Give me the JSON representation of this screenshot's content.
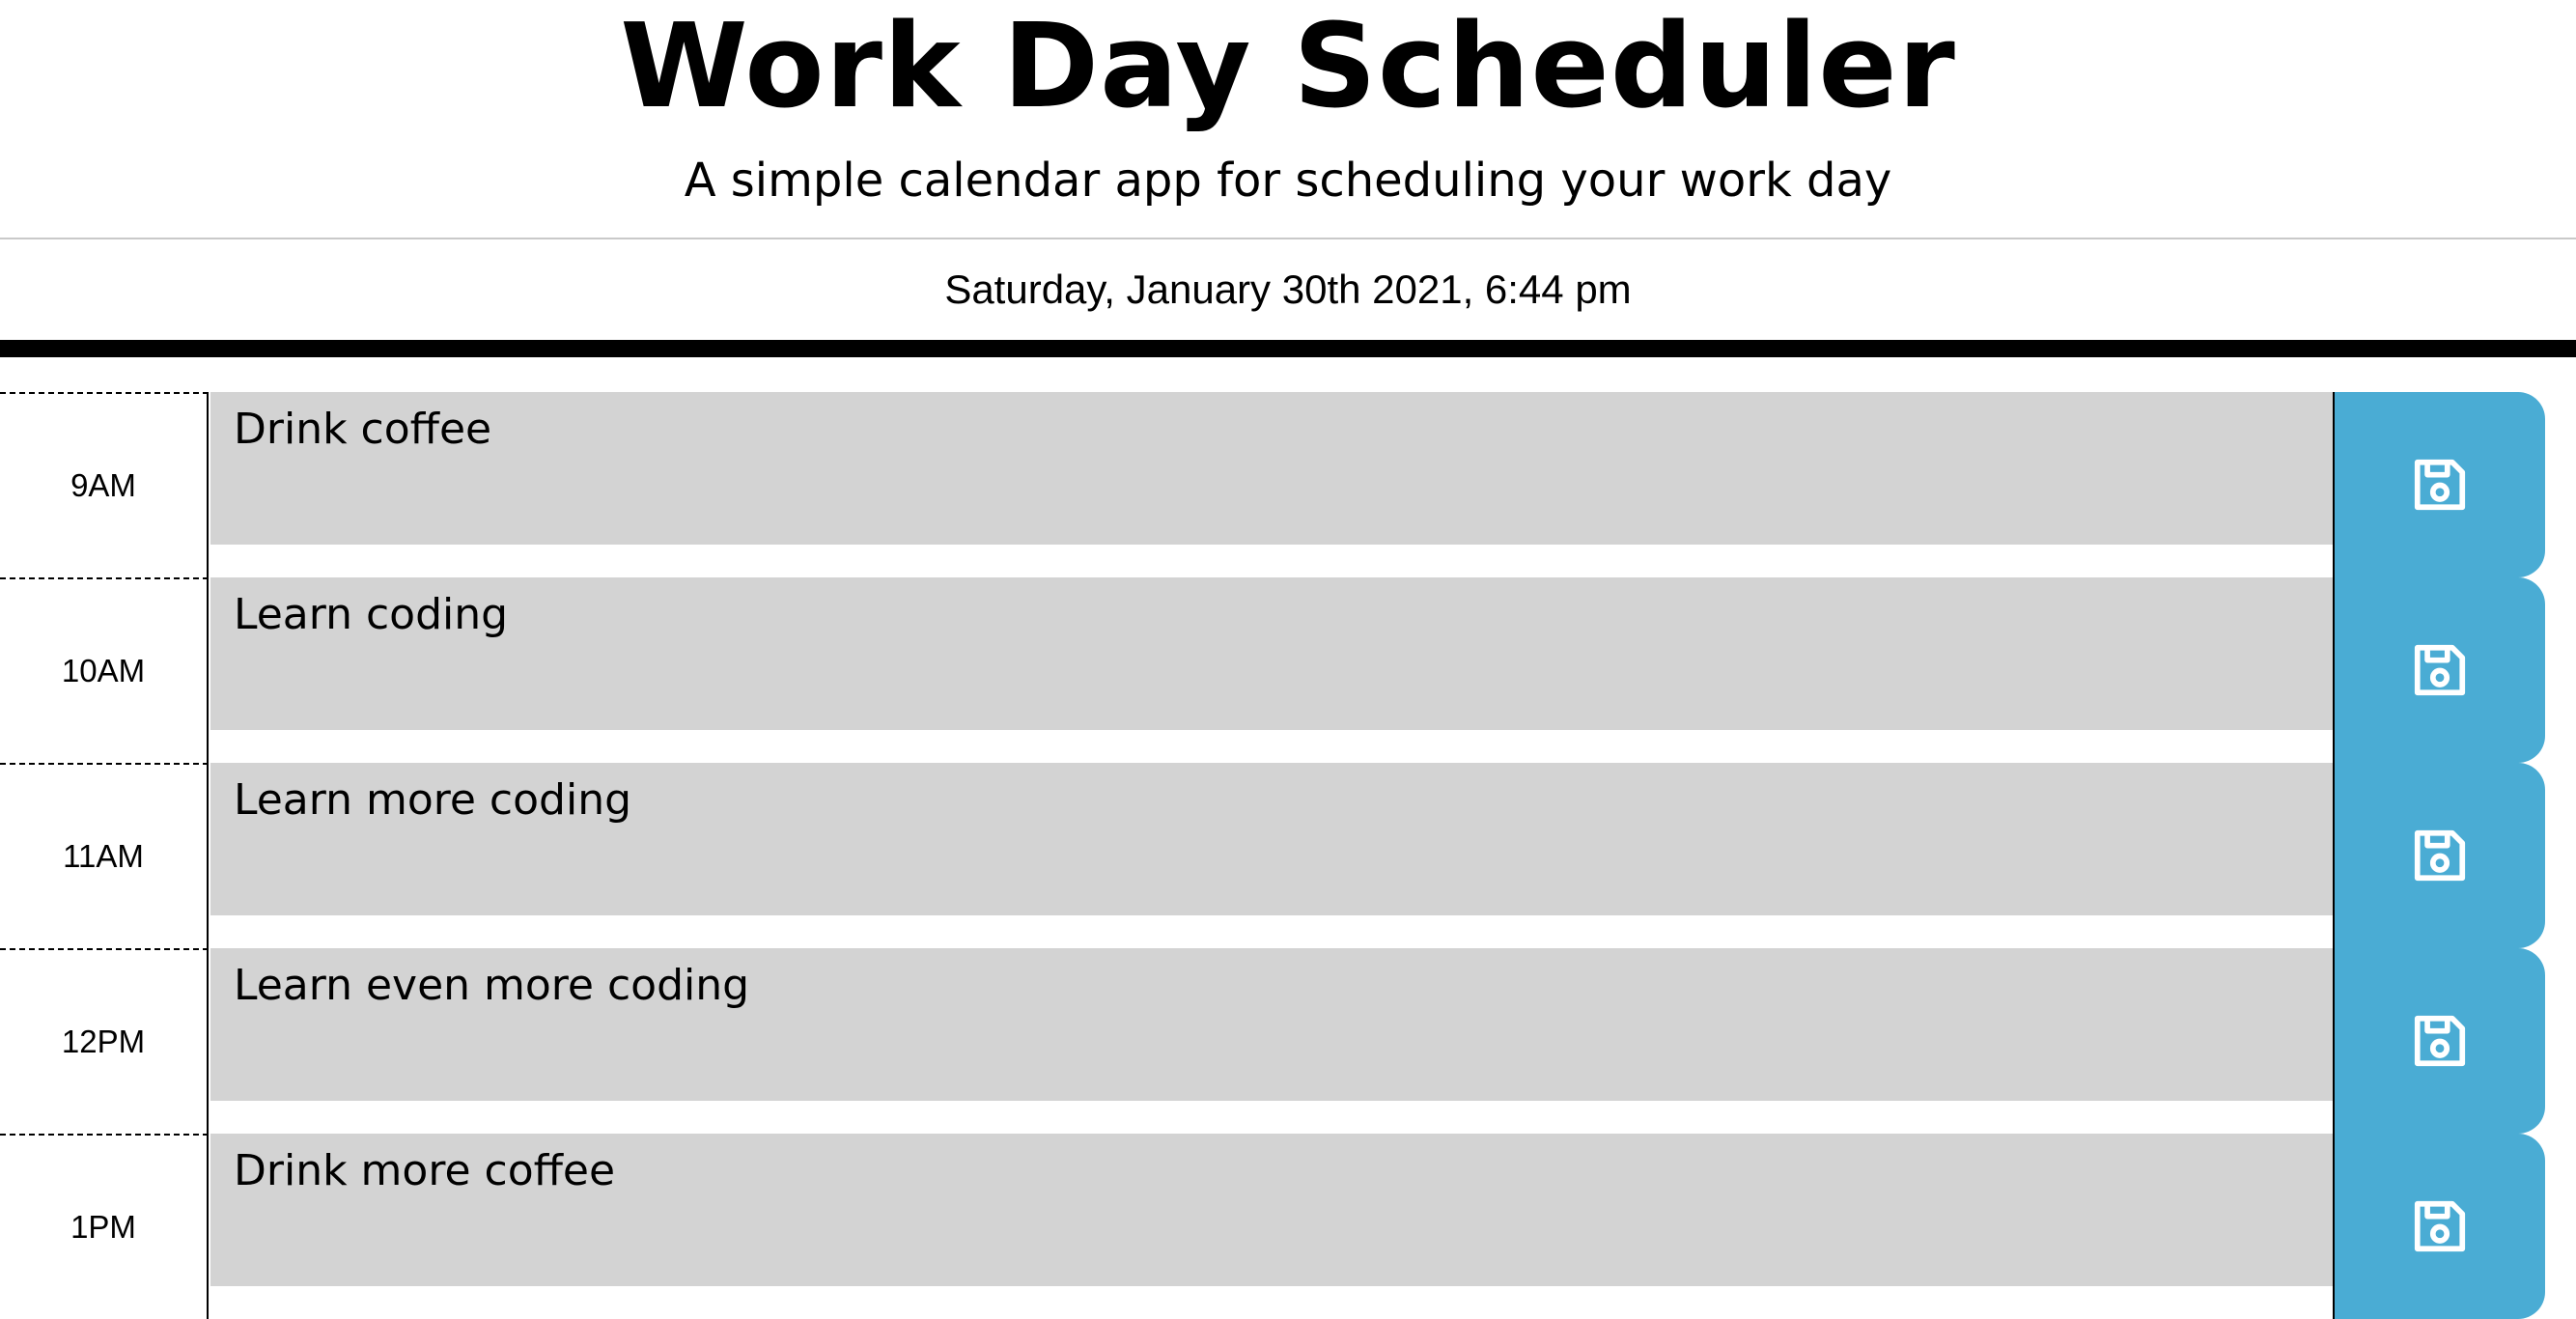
{
  "header": {
    "title": "Work Day Scheduler",
    "subtitle": "A simple calendar app for scheduling your work day",
    "current_day": "Saturday, January 30th 2021, 6:44 pm"
  },
  "schedule": [
    {
      "hour": "9AM",
      "text": "Drink coffee",
      "save_icon": "floppy-disk-icon"
    },
    {
      "hour": "10AM",
      "text": "Learn coding",
      "save_icon": "floppy-disk-icon"
    },
    {
      "hour": "11AM",
      "text": "Learn more coding",
      "save_icon": "floppy-disk-icon"
    },
    {
      "hour": "12PM",
      "text": "Learn even more coding",
      "save_icon": "floppy-disk-icon"
    },
    {
      "hour": "1PM",
      "text": "Drink more coffee",
      "save_icon": "floppy-disk-icon"
    }
  ],
  "colors": {
    "past_block": "#d3d3d3",
    "save_button": "#4aacd4"
  }
}
